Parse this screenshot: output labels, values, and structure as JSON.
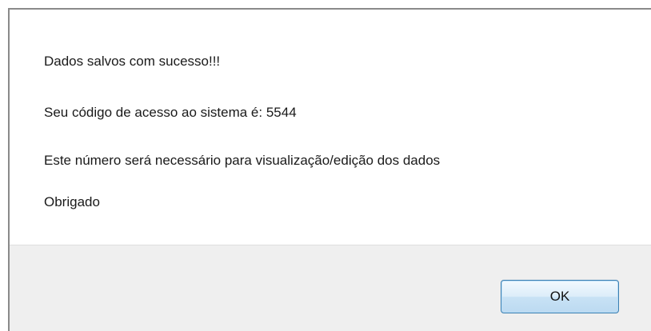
{
  "dialog": {
    "messages": [
      "Dados salvos com sucesso!!!",
      "Seu código  de acesso ao sistema é: 5544",
      "Este número será necessário para visualização/edição dos dados",
      "Obrigado"
    ],
    "ok_label": "OK"
  }
}
